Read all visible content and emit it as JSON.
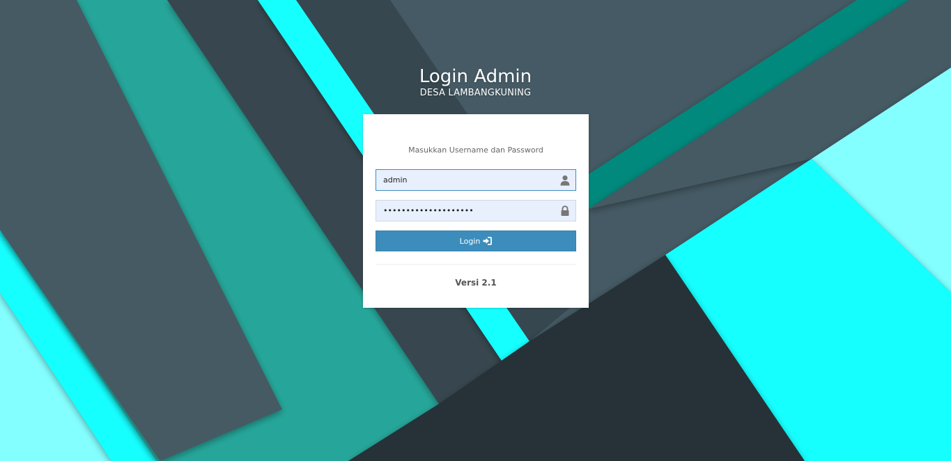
{
  "colors": {
    "accent": "#3c8dbc",
    "bg_dark": "#263238",
    "bg_slate": "#455a64",
    "bg_teal": "#26a69a",
    "bg_cyan": "#18ffff",
    "bg_light_cyan": "#84ffff",
    "field_fill": "#e8f0fe"
  },
  "header": {
    "title": "Login Admin",
    "subtitle": "DESA LAMBANGKUNING"
  },
  "login": {
    "message": "Masukkan Username dan Password",
    "username": {
      "value": "admin",
      "icon": "user-icon"
    },
    "password": {
      "value": "••••••••••••••••••••",
      "icon": "lock-icon"
    },
    "button_label": "Login",
    "button_icon": "sign-in-icon"
  },
  "footer": {
    "version": "Versi 2.1"
  }
}
